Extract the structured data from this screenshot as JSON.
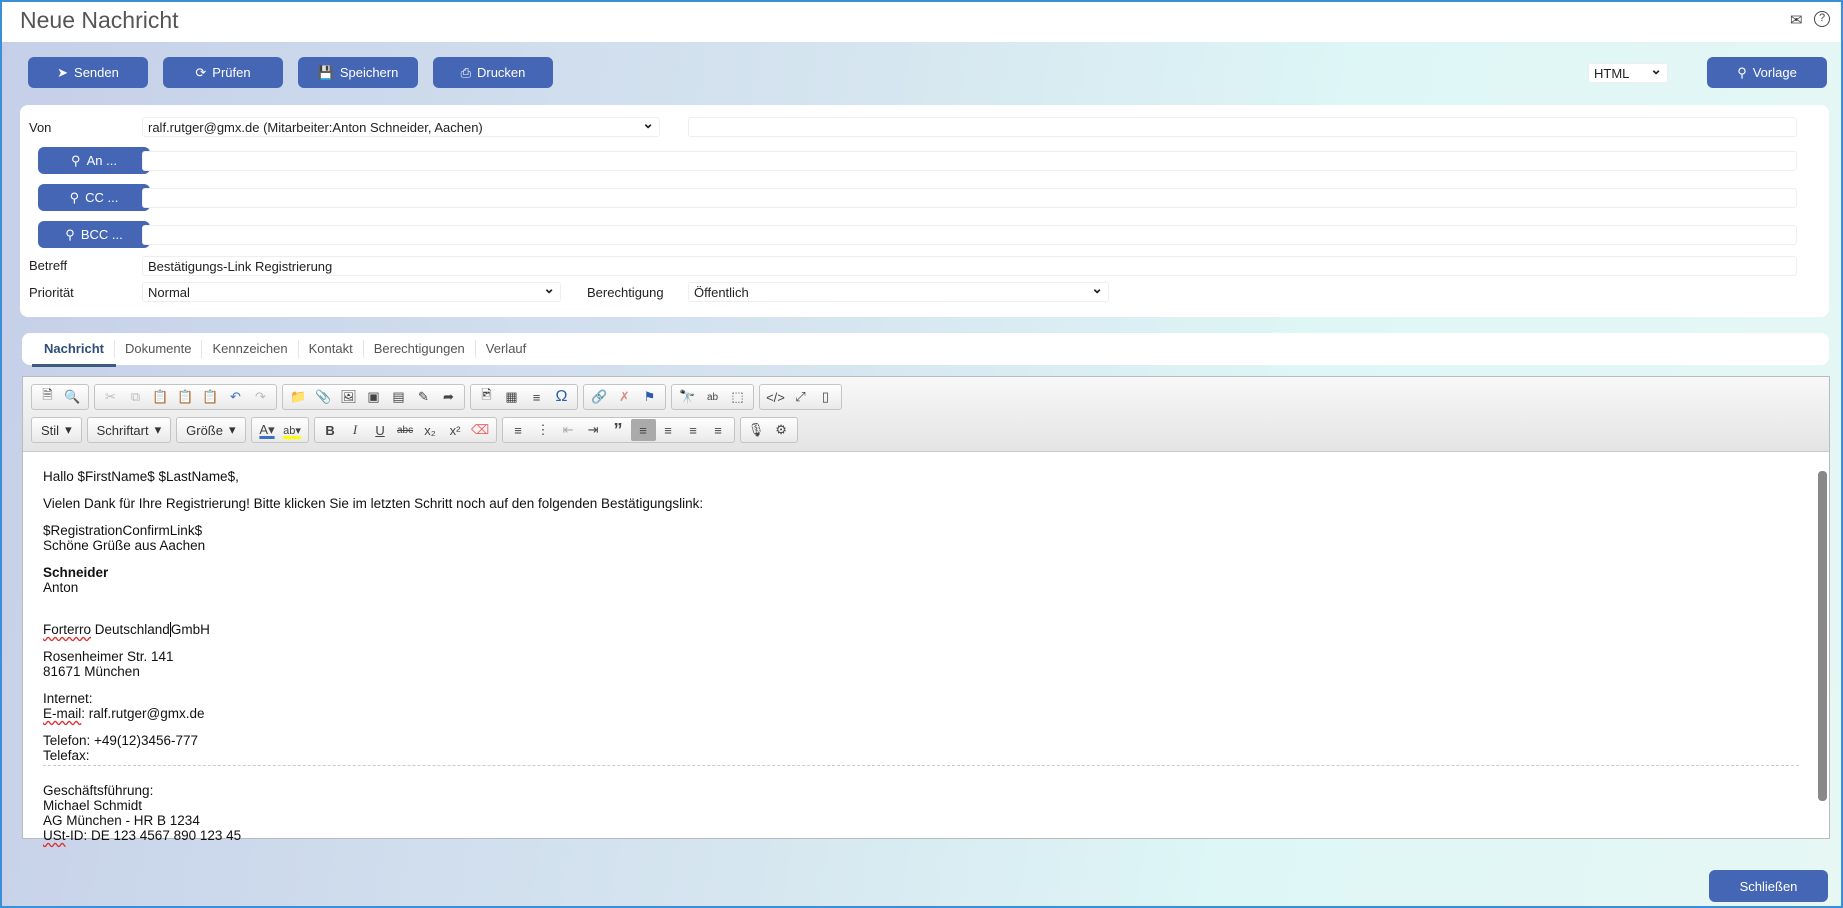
{
  "window": {
    "title": "Neue Nachricht",
    "icons": [
      "mail-icon",
      "help-icon"
    ]
  },
  "toolbar": {
    "send": "Senden",
    "check": "Prüfen",
    "save": "Speichern",
    "print": "Drucken",
    "format": "HTML",
    "template": "Vorlage"
  },
  "form": {
    "from_label": "Von",
    "from_value": "ralf.rutger@gmx.de (Mitarbeiter:Anton Schneider, Aachen)",
    "to_button": "An ...",
    "cc_button": "CC ...",
    "bcc_button": "BCC ...",
    "subject_label": "Betreff",
    "subject_value": "Bestätigungs-Link Registrierung",
    "priority_label": "Priorität",
    "priority_value": "Normal",
    "permission_label": "Berechtigung",
    "permission_value": "Öffentlich"
  },
  "tabs": [
    {
      "label": "Nachricht",
      "active": true
    },
    {
      "label": "Dokumente"
    },
    {
      "label": "Kennzeichen"
    },
    {
      "label": "Kontakt"
    },
    {
      "label": "Berechtigungen"
    },
    {
      "label": "Verlauf"
    }
  ],
  "editor": {
    "combos": {
      "style": "Stil",
      "font": "Schriftart",
      "size": "Größe"
    },
    "body": {
      "greeting": "Hallo $FirstName$ $LastName$,",
      "intro": "Vielen Dank für Ihre Registrierung! Bitte klicken Sie im letzten Schritt noch auf den folgenden Bestätigungslink:",
      "link": "$RegistrationConfirmLink$",
      "regards": "Schöne Grüße aus Aachen",
      "last_name": "Schneider",
      "first_name": "Anton",
      "company_a": "Forterro",
      "company_b": " Deutschland",
      "company_c": "GmbH",
      "street": "Rosenheimer Str. 141",
      "city": "81671 München",
      "internet": "Internet:",
      "email_a": "E-mail",
      "email_b": ": ralf.rutger@gmx.de",
      "phone": "Telefon: +49(12)3456-777",
      "fax": "Telefax:",
      "mgmt": "Geschäftsführung:",
      "ceo": "Michael Schmidt",
      "court": "AG München - HR B 1234",
      "vat_a": "USt",
      "vat_b": "-ID: DE 123 4567 890 123 45"
    }
  },
  "footer": {
    "close": "Schließen"
  },
  "colors": {
    "button": "#4466b4",
    "tab_active": "#2d4d7a"
  }
}
